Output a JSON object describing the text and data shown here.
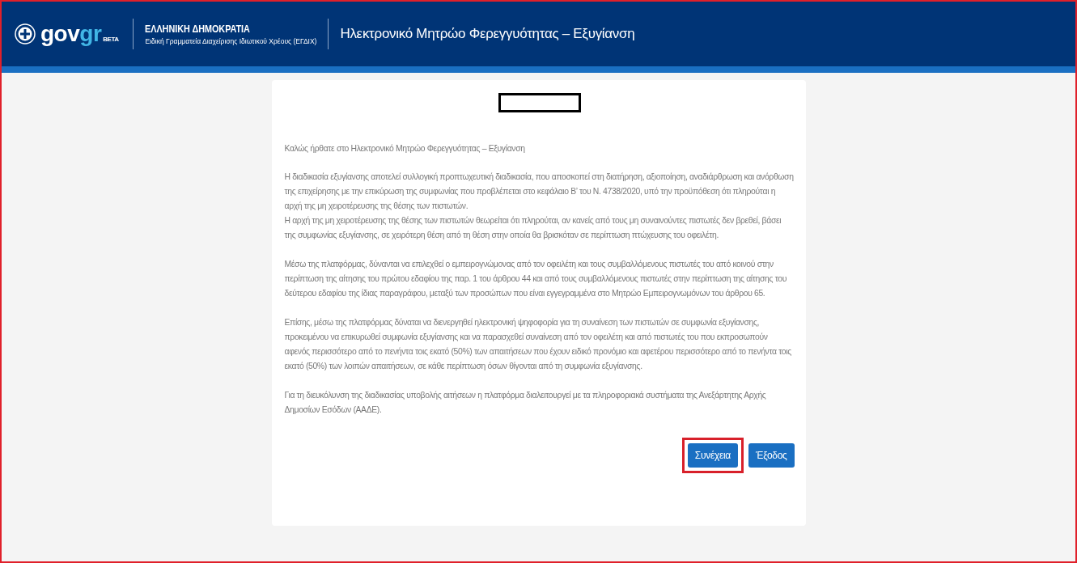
{
  "header": {
    "logo": {
      "main": "gov",
      "accent": "gr",
      "badge": "BETA"
    },
    "org_title": "ΕΛΛΗΝΙΚΗ ΔΗΜΟΚΡΑΤΙΑ",
    "org_subtitle": "Ειδική Γραμματεία Διαχείρισης Ιδιωτικού Χρέους (ΕΓΔΙΧ)",
    "app_title": "Ηλεκτρονικό Μητρώο Φερεγγυότητας – Εξυγίανση"
  },
  "content": {
    "welcome": "Καλώς ήρθατε στο Ηλεκτρονικό Μητρώο Φερεγγυότητας – Εξυγίανση",
    "blocks": [
      {
        "texts": [
          "Η διαδικασία εξυγίανσης αποτελεί συλλογική προπτωχευτική διαδικασία, που αποσκοπεί στη διατήρηση, αξιοποίηση, αναδιάρθρωση και ανόρθωση της επιχείρησης με την επικύρωση της συμφωνίας που προβλέπεται στο κεφάλαιο Β’ του Ν. 4738/2020, υπό την προϋπόθεση ότι πληρούται η αρχή της μη χειροτέρευσης της θέσης των πιστωτών.",
          "Η αρχή της μη χειροτέρευσης της θέσης των πιστωτών θεωρείται ότι πληρούται, αν κανείς από τους μη συναινούντες πιστωτές δεν βρεθεί, βάσει της συμφωνίας εξυγίανσης, σε χειρότερη θέση από τη θέση στην οποία θα βρισκόταν σε περίπτωση πτώχευσης του οφειλέτη."
        ]
      },
      {
        "texts": [
          "Μέσω της πλατφόρμας, δύνανται να επιλεχθεί ο εμπειρογνώμονας από τον οφειλέτη και τους συμβαλλόμενους πιστωτές του από κοινού στην περίπτωση της αίτησης του πρώτου εδαφίου της παρ. 1 του άρθρου 44 και από τους συμβαλλόμενους πιστωτές στην περίπτωση της αίτησης του δεύτερου εδαφίου της ίδιας παραγράφου, μεταξύ των προσώπων που είναι εγγεγραμμένα στο Μητρώο Εμπειρογνωμόνων του άρθρου 65."
        ]
      },
      {
        "texts": [
          "Επίσης, μέσω της πλατφόρμας δύναται να διενεργηθεί ηλεκτρονική ψηφοφορία για τη συναίνεση των πιστωτών σε συμφωνία εξυγίανσης, προκειμένου να επικυρωθεί συμφωνία εξυγίανσης και να παρασχεθεί συναίνεση από τον οφειλέτη και από πιστωτές του που εκπροσωπούν αφενός περισσότερο από το πενήντα τοις εκατό (50%) των απαιτήσεων που έχουν ειδικό προνόμιο και αφετέρου περισσότερο από το πενήντα τοις εκατό (50%) των λοιπών απαιτήσεων, σε κάθε περίπτωση όσων θίγονται από τη συμφωνία εξυγίανσης."
        ]
      },
      {
        "texts": [
          "Για τη διευκόλυνση της διαδικασίας υποβολής αιτήσεων η πλατφόρμα διαλειτουργεί με τα πληροφοριακά συστήματα της Ανεξάρτητης Αρχής Δημοσίων Εσόδων (ΑΑΔΕ)."
        ]
      }
    ],
    "buttons": [
      {
        "label": "Συνέχεια",
        "highlighted": true
      },
      {
        "label": "Έξοδος",
        "highlighted": false
      }
    ]
  }
}
